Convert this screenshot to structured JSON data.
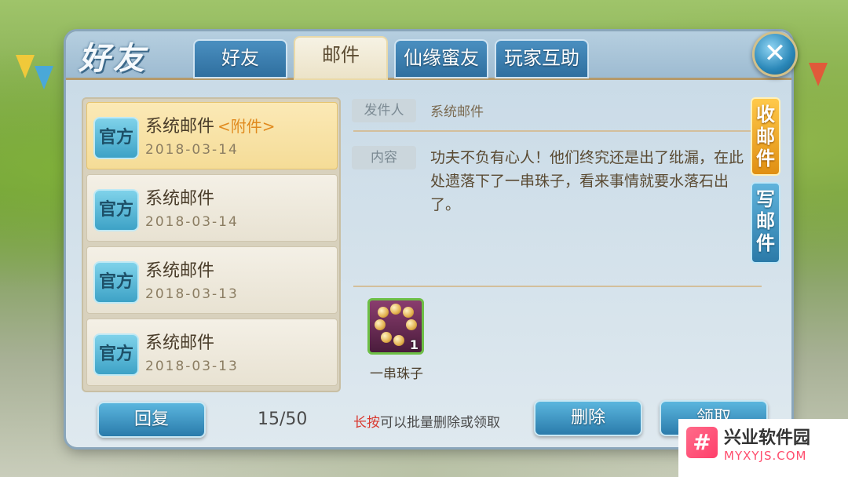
{
  "panel": {
    "title": "好友",
    "close_icon": "close-icon",
    "tabs": [
      {
        "label": "好友",
        "active": false
      },
      {
        "label": "邮件",
        "active": true
      },
      {
        "label": "仙缘蜜友",
        "active": false
      },
      {
        "label": "玩家互助",
        "active": false
      }
    ]
  },
  "mail_list": [
    {
      "badge": "官方",
      "sender": "系统邮件",
      "attachment": "<附件>",
      "date": "2018-03-14",
      "selected": true
    },
    {
      "badge": "官方",
      "sender": "系统邮件",
      "attachment": "",
      "date": "2018-03-14",
      "selected": false
    },
    {
      "badge": "官方",
      "sender": "系统邮件",
      "attachment": "",
      "date": "2018-03-13",
      "selected": false
    },
    {
      "badge": "官方",
      "sender": "系统邮件",
      "attachment": "",
      "date": "2018-03-13",
      "selected": false
    }
  ],
  "detail": {
    "sender_label": "发件人",
    "sender_value": "系统邮件",
    "content_label": "内容",
    "content": "功夫不负有心人！他们终究还是出了纰漏，在此处遗落下了一串珠子，看来事情就要水落石出了。",
    "attachment_item": {
      "name": "一串珠子",
      "count": "1",
      "icon": "bead-string-icon"
    }
  },
  "side_tabs": [
    {
      "label": "收邮件",
      "active": true
    },
    {
      "label": "写邮件",
      "active": false
    }
  ],
  "footer": {
    "reply_label": "回复",
    "count": "15/50",
    "hint_emphasis": "长按",
    "hint_rest": "可以批量删除或领取",
    "delete_label": "删除",
    "claim_label": "领取"
  },
  "watermark": {
    "title": "兴业软件园",
    "subtitle": "MYXYJS.COM",
    "logo_icon": "hash-logo-icon"
  },
  "colors": {
    "accent_blue": "#2a7bab",
    "accent_gold": "#e08f12",
    "selected_row": "#f5dc97",
    "hint_red": "#d9392f"
  }
}
